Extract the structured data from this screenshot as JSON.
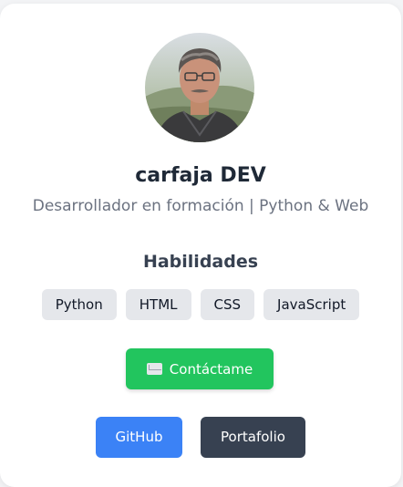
{
  "profile": {
    "name": "carfaja DEV",
    "role": "Desarrollador en formación | Python & Web"
  },
  "skills": {
    "title": "Habilidades",
    "items": [
      "Python",
      "HTML",
      "CSS",
      "JavaScript"
    ]
  },
  "contact": {
    "label": "Contáctame",
    "icon": "envelope-icon"
  },
  "links": {
    "github_label": "GitHub",
    "portfolio_label": "Portafolio"
  },
  "colors": {
    "contact": "#22c55e",
    "github": "#3b82f6",
    "portfolio": "#374151",
    "skill_bg": "#e5e7eb"
  }
}
